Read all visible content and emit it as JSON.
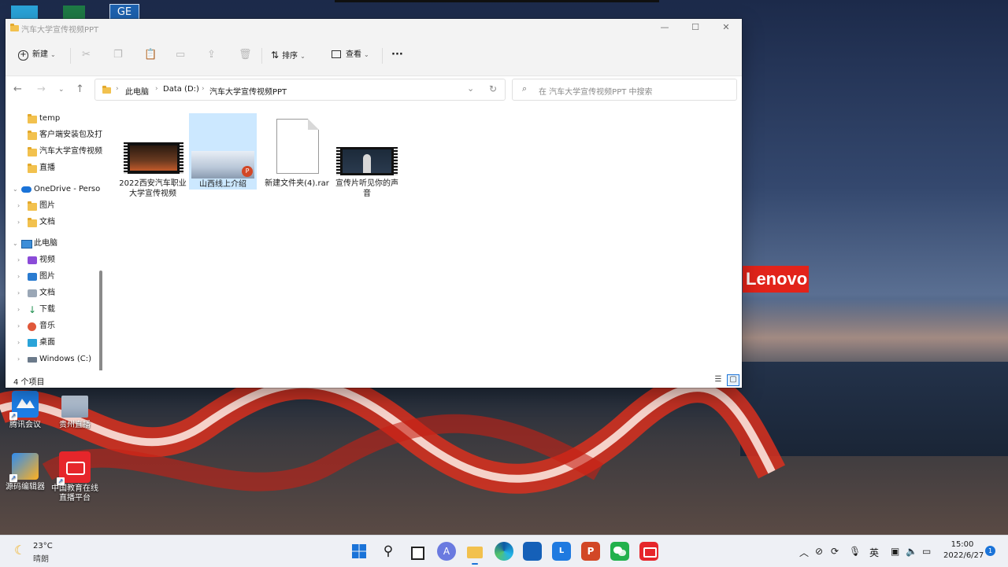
{
  "desktop": {
    "brand": "Lenovo",
    "brand_text": "Lenovo",
    "icons": [
      {
        "label": "腾讯会议"
      },
      {
        "label": "贵州直播"
      },
      {
        "label": "源码编辑器"
      },
      {
        "label": "中国教育在线直播平台"
      }
    ],
    "top_icon_text": "GE"
  },
  "window": {
    "title": "汽车大学宣传视频PPT",
    "controls": {
      "minimize": "—",
      "maximize": "☐",
      "close": "✕"
    },
    "toolbar": {
      "new_label": "新建",
      "sort_label": "排序",
      "view_label": "查看",
      "more_label": "···"
    },
    "address": {
      "crumbs": [
        "此电脑",
        "Data (D:)",
        "汽车大学宣传视频PPT"
      ]
    },
    "search": {
      "placeholder": "在 汽车大学宣传视频PPT 中搜索"
    },
    "sidebar": {
      "items": [
        {
          "label": "temp"
        },
        {
          "label": "客户端安装包及打"
        },
        {
          "label": "汽车大学宣传视频"
        },
        {
          "label": "直播"
        },
        {
          "label": "OneDrive - Perso"
        },
        {
          "label": "图片"
        },
        {
          "label": "文档"
        },
        {
          "label": "此电脑"
        },
        {
          "label": "视频"
        },
        {
          "label": "图片"
        },
        {
          "label": "文档"
        },
        {
          "label": "下载"
        },
        {
          "label": "音乐"
        },
        {
          "label": "桌面"
        },
        {
          "label": "Windows (C:)"
        }
      ]
    },
    "files": [
      {
        "name": "2022西安汽车职业大学宣传视频",
        "type": "video"
      },
      {
        "name": "山西线上介绍",
        "type": "pptx"
      },
      {
        "name": "新建文件夹(4).rar",
        "type": "rar"
      },
      {
        "name": "宣传片听见你的声音",
        "type": "video"
      }
    ],
    "status": {
      "count": "4 个项目"
    }
  },
  "taskbar": {
    "weather": {
      "temp": "23°C",
      "desc": "晴朗"
    },
    "ime": "英",
    "time": "15:00",
    "date": "2022/6/27",
    "notification_count": "1"
  },
  "colors": {
    "accent": "#1a73d8",
    "folder": "#f2c14e",
    "lenovo": "#e2231a"
  }
}
